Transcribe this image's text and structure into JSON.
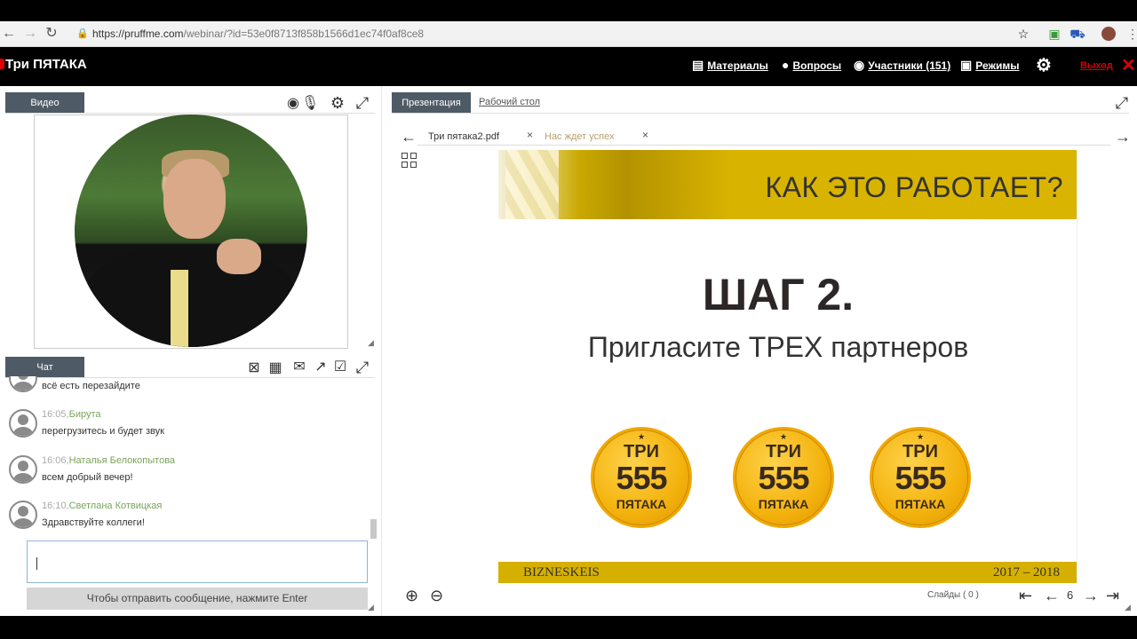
{
  "browser": {
    "url_host": "https://pruffme.com",
    "url_path": "/webinar/?id=53e0f8713f858b1566d1ec74f0af8ce8",
    "back": "←",
    "forward": "→",
    "reload": "↻",
    "lock": "🔒",
    "star": "☆"
  },
  "app": {
    "logo": "Три ПЯТАКА",
    "menu": {
      "materials": "Материалы",
      "questions": "Вопросы",
      "participants": "Участники (151)",
      "modes": "Режимы"
    },
    "exit": "Выход",
    "exit_x": "✕"
  },
  "video_panel": {
    "tab": "Видео"
  },
  "chat_panel": {
    "tab": "Чат",
    "messages": [
      {
        "time": "",
        "author": "",
        "text": "всё есть перезайдите"
      },
      {
        "time": "16:05,",
        "author": "Бирута",
        "text": "перегрузитесь и будет звук"
      },
      {
        "time": "16:06,",
        "author": "Наталья Белокопытова",
        "text": "всем добрый вечер!"
      },
      {
        "time": "16:10,",
        "author": "Светлана Котвицкая",
        "text": "Здравствуйте коллеги!"
      }
    ],
    "send_hint": "Чтобы отправить сообщение, нажмите Enter"
  },
  "presentation": {
    "tab_active": "Презентация",
    "tab_desktop": "Рабочий стол",
    "files": [
      {
        "name": "Три пятака2.pdf"
      },
      {
        "name": "Нас ждет успех"
      }
    ],
    "close": "×",
    "prev_arrow": "←",
    "next_arrow": "→",
    "slide": {
      "title": "КАК ЭТО РАБОТАЕТ?",
      "step": "ШАГ 2.",
      "subtitle": "Пригласите ТРЕХ партнеров",
      "coin_top": "ТРИ",
      "coin_num": "555",
      "coin_bottom": "ПЯТАКА",
      "footer_left": "BIZNESKEIS",
      "footer_right": "2017 – 2018"
    },
    "zoom_in": "⊕",
    "zoom_out": "⊖",
    "slides_label": "Слайды (",
    "slides_count": "0",
    "slides_close": ")",
    "page": "6",
    "first": "⇤",
    "prev": "←",
    "next": "→",
    "last": "⇥"
  }
}
